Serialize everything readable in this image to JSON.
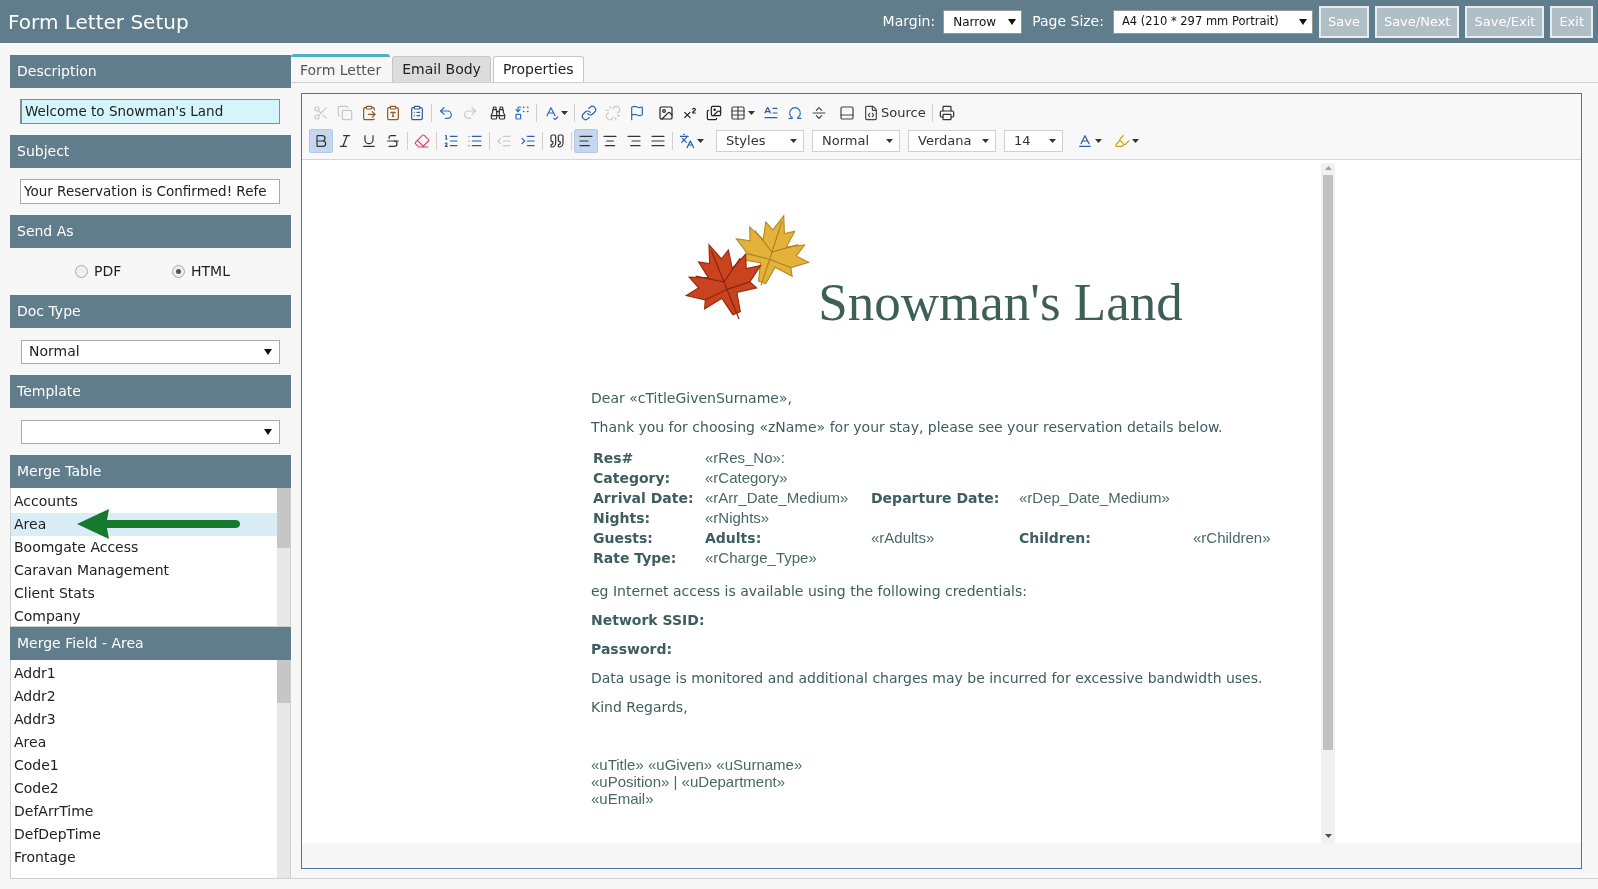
{
  "header": {
    "title": "Form Letter Setup",
    "margin": {
      "label": "Margin:",
      "value": "Narrow"
    },
    "page_size": {
      "label": "Page Size:",
      "value": "A4 (210 * 297 mm Portrait)"
    },
    "buttons": [
      "Save",
      "Save/Next",
      "Save/Exit",
      "Exit"
    ]
  },
  "sidebar": {
    "sections": [
      {
        "title": "Description",
        "kind": "text",
        "value": "Welcome to Snowman's Land",
        "focused": true
      },
      {
        "title": "Subject",
        "kind": "text",
        "value": "Your Reservation is Confirmed! Refe",
        "focused": false
      },
      {
        "title": "Send As",
        "kind": "radio",
        "options": [
          {
            "label": "PDF",
            "selected": false
          },
          {
            "label": "HTML",
            "selected": true
          }
        ]
      },
      {
        "title": "Doc Type",
        "kind": "select",
        "value": "Normal"
      },
      {
        "title": "Template",
        "kind": "select"
      },
      {
        "title": "Merge Table",
        "kind": "list",
        "annotated": true,
        "items": [
          {
            "label": "Accounts",
            "selected": false
          },
          {
            "label": "Area",
            "selected": true
          },
          {
            "label": "Boomgate Access",
            "selected": false
          },
          {
            "label": "Caravan Management",
            "selected": false
          },
          {
            "label": "Client Stats",
            "selected": false
          },
          {
            "label": "Company",
            "selected": false
          }
        ]
      },
      {
        "title": "Merge Field - Area",
        "kind": "list",
        "annotated": false,
        "items": [
          {
            "label": "Addr1",
            "selected": false
          },
          {
            "label": "Addr2",
            "selected": false
          },
          {
            "label": "Addr3",
            "selected": false
          },
          {
            "label": "Area",
            "selected": false
          },
          {
            "label": "Code1",
            "selected": false
          },
          {
            "label": "Code2",
            "selected": false
          },
          {
            "label": "DefArrTime",
            "selected": false
          },
          {
            "label": "DefDepTime",
            "selected": false
          },
          {
            "label": "Frontage",
            "selected": false
          }
        ]
      }
    ]
  },
  "tabs": [
    {
      "label": "Form Letter",
      "selected": true,
      "hovered": false
    },
    {
      "label": "Email Body",
      "selected": false,
      "hovered": false
    },
    {
      "label": "Properties",
      "selected": false,
      "hovered": true
    }
  ],
  "editor": {
    "toolbar": {
      "rows": [
        [
          {
            "kind": "button",
            "disabled": true,
            "active": false
          },
          {
            "kind": "button",
            "disabled": true,
            "active": false
          },
          {
            "kind": "button",
            "disabled": false,
            "active": false
          },
          {
            "kind": "button",
            "disabled": false,
            "active": false
          },
          {
            "kind": "button",
            "disabled": false,
            "active": false
          },
          {
            "kind": "separator"
          },
          {
            "kind": "button",
            "disabled": false,
            "active": false
          },
          {
            "kind": "button",
            "disabled": true,
            "active": false
          },
          {
            "kind": "button",
            "disabled": false,
            "active": false
          },
          {
            "kind": "button",
            "disabled": false,
            "active": false
          },
          {
            "kind": "separator"
          },
          {
            "kind": "menu-button",
            "disabled": false,
            "active": false
          },
          {
            "kind": "separator"
          },
          {
            "kind": "button",
            "disabled": false,
            "active": false
          },
          {
            "kind": "button",
            "disabled": true,
            "active": false
          },
          {
            "kind": "button",
            "disabled": false,
            "active": false
          },
          {
            "kind": "button",
            "disabled": false,
            "active": false
          },
          {
            "kind": "button",
            "disabled": false,
            "active": false
          },
          {
            "kind": "button",
            "disabled": false,
            "active": false
          },
          {
            "kind": "menu-button",
            "disabled": false,
            "active": false
          },
          {
            "kind": "button",
            "disabled": false,
            "active": false
          },
          {
            "kind": "button",
            "disabled": false,
            "active": false
          },
          {
            "kind": "button",
            "disabled": false,
            "active": false
          },
          {
            "kind": "button",
            "disabled": false,
            "active": false
          },
          {
            "kind": "labelled-button",
            "label": "Source",
            "disabled": false,
            "active": false
          },
          {
            "kind": "separator"
          },
          {
            "kind": "button",
            "disabled": false,
            "active": false
          }
        ],
        [
          {
            "kind": "button",
            "disabled": false,
            "active": true
          },
          {
            "kind": "button",
            "disabled": false,
            "active": false
          },
          {
            "kind": "button",
            "disabled": false,
            "active": false
          },
          {
            "kind": "button",
            "disabled": false,
            "active": false
          },
          {
            "kind": "separator"
          },
          {
            "kind": "button",
            "disabled": false,
            "active": false
          },
          {
            "kind": "separator"
          },
          {
            "kind": "button",
            "disabled": false,
            "active": false
          },
          {
            "kind": "button",
            "disabled": false,
            "active": false
          },
          {
            "kind": "separator"
          },
          {
            "kind": "button",
            "disabled": true,
            "active": false
          },
          {
            "kind": "button",
            "disabled": false,
            "active": false
          },
          {
            "kind": "separator"
          },
          {
            "kind": "button",
            "disabled": false,
            "active": false
          },
          {
            "kind": "separator"
          },
          {
            "kind": "button",
            "disabled": false,
            "active": true
          },
          {
            "kind": "button",
            "disabled": false,
            "active": false
          },
          {
            "kind": "button",
            "disabled": false,
            "active": false
          },
          {
            "kind": "button",
            "disabled": false,
            "active": false
          },
          {
            "kind": "separator"
          },
          {
            "kind": "menu-button",
            "disabled": false,
            "active": false
          },
          {
            "kind": "combo",
            "value": "Styles"
          },
          {
            "kind": "combo",
            "value": "Normal"
          },
          {
            "kind": "combo",
            "value": "Verdana"
          },
          {
            "kind": "combo",
            "value": "14"
          },
          {
            "kind": "menu-button",
            "disabled": false,
            "active": false
          },
          {
            "kind": "menu-button",
            "disabled": false,
            "active": false
          }
        ]
      ]
    },
    "document": {
      "logo_text": "Snowman's Land",
      "blocks": [
        {
          "kind": "paragraph",
          "text": "Dear «cTitleGivenSurname»,"
        },
        {
          "kind": "paragraph",
          "text": "Thank you for choosing «zName» for your stay, please see your reservation details below."
        },
        {
          "kind": "table",
          "rows": [
            [
              {
                "kind": "label",
                "text": "Res#"
              },
              {
                "kind": "value",
                "text": "«rRes_No»:"
              }
            ],
            [
              {
                "kind": "label",
                "text": "Category:"
              },
              {
                "kind": "value",
                "text": "«rCategory»"
              }
            ],
            [
              {
                "kind": "label",
                "text": "Arrival Date:"
              },
              {
                "kind": "value",
                "text": "«rArr_Date_Medium»"
              },
              {
                "kind": "label",
                "text": "Departure Date:"
              },
              {
                "kind": "value",
                "text": "«rDep_Date_Medium»"
              }
            ],
            [
              {
                "kind": "label",
                "text": "Nights:"
              },
              {
                "kind": "value",
                "text": "«rNights»"
              }
            ],
            [
              {
                "kind": "label",
                "text": "Guests:"
              },
              {
                "kind": "label",
                "text": "Adults:"
              },
              {
                "kind": "value",
                "text": "«rAdults»"
              },
              {
                "kind": "label",
                "text": "Children:"
              },
              {
                "kind": "value",
                "text": "«rChildren»"
              }
            ],
            [
              {
                "kind": "label",
                "text": "Rate Type:"
              },
              {
                "kind": "value",
                "text": "«rCharge_Type»"
              }
            ]
          ]
        },
        {
          "kind": "paragraph",
          "text": "eg Internet access is available using the following credentials:"
        },
        {
          "kind": "heading",
          "text": "Network SSID:"
        },
        {
          "kind": "heading",
          "text": "Password:"
        },
        {
          "kind": "paragraph",
          "text": "Data usage is monitored and additional charges may be incurred for excessive bandwidth uses."
        },
        {
          "kind": "paragraph",
          "text": "Kind Regards,"
        },
        {
          "kind": "signature",
          "lines": [
            "«uTitle» «uGiven» «uSurname»",
            "«uPosition» | «uDepartment»",
            "«uEmail»"
          ]
        }
      ]
    }
  }
}
